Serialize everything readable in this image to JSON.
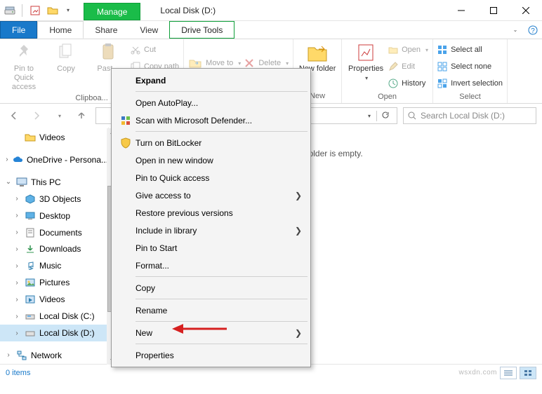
{
  "window": {
    "title": "Local Disk (D:)",
    "contextual_tab_group": "Manage",
    "contextual_tab": "Drive Tools"
  },
  "ribbonTabs": {
    "file": "File",
    "home": "Home",
    "share": "Share",
    "view": "View"
  },
  "ribbon": {
    "clipboard": {
      "label": "Clipboa...",
      "pin": "Pin to Quick access",
      "copy": "Copy",
      "paste": "Past...",
      "cut": "Cut",
      "copyPath": "Copy path"
    },
    "organize": {
      "moveTo": "Move to",
      "delete": "Delete"
    },
    "new": {
      "label": "New",
      "newFolder": "New folder"
    },
    "open": {
      "label": "Open",
      "properties": "Properties",
      "open": "Open",
      "edit": "Edit",
      "history": "History"
    },
    "select": {
      "label": "Select",
      "selectAll": "Select all",
      "selectNone": "Select none",
      "invert": "Invert selection"
    }
  },
  "search": {
    "placeholder": "Search Local Disk (D:)"
  },
  "sidebar": {
    "items": [
      {
        "label": "Videos"
      },
      {
        "label": "OneDrive - Persona..."
      },
      {
        "label": "This PC"
      },
      {
        "label": "3D Objects"
      },
      {
        "label": "Desktop"
      },
      {
        "label": "Documents"
      },
      {
        "label": "Downloads"
      },
      {
        "label": "Music"
      },
      {
        "label": "Pictures"
      },
      {
        "label": "Videos"
      },
      {
        "label": "Local Disk (C:)"
      },
      {
        "label": "Local Disk (D:)"
      },
      {
        "label": "Network"
      }
    ]
  },
  "empty": "This folder is empty.",
  "status": {
    "items": "0 items",
    "watermark": "wsxdn.com"
  },
  "context": {
    "expand": "Expand",
    "autoplay": "Open AutoPlay...",
    "defender": "Scan with Microsoft Defender...",
    "bitlocker": "Turn on BitLocker",
    "newwindow": "Open in new window",
    "pinquick": "Pin to Quick access",
    "giveaccess": "Give access to",
    "restore": "Restore previous versions",
    "library": "Include in library",
    "pinstart": "Pin to Start",
    "format": "Format...",
    "copy": "Copy",
    "rename": "Rename",
    "new": "New",
    "properties": "Properties"
  }
}
